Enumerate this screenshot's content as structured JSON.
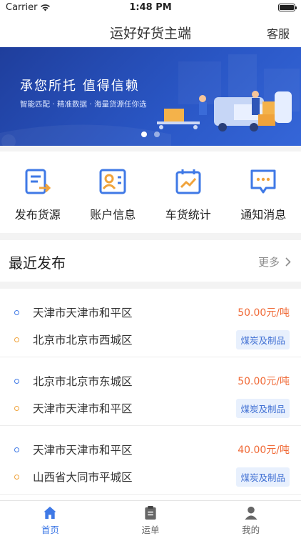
{
  "status_bar": {
    "carrier": "Carrier",
    "time": "1:48 PM"
  },
  "nav": {
    "title": "运好好货主端",
    "service": "客服"
  },
  "banner": {
    "title": "承您所托  值得信赖",
    "subtitle": "智能匹配 · 精准数据 · 海量货源任你选",
    "active_index": 0,
    "count": 2
  },
  "menu": [
    {
      "label": "发布货源",
      "icon": "publish-icon"
    },
    {
      "label": "账户信息",
      "icon": "account-icon"
    },
    {
      "label": "车货统计",
      "icon": "stats-icon"
    },
    {
      "label": "通知消息",
      "icon": "message-icon"
    }
  ],
  "recent": {
    "title": "最近发布",
    "more": "更多"
  },
  "shipments": [
    {
      "from": "天津市天津市和平区",
      "to": "北京市北京市西城区",
      "price": "50.00元/吨",
      "tag": "煤炭及制品"
    },
    {
      "from": "北京市北京市东城区",
      "to": "天津市天津市和平区",
      "price": "50.00元/吨",
      "tag": "煤炭及制品"
    },
    {
      "from": "天津市天津市和平区",
      "to": "山西省大同市平城区",
      "price": "40.00元/吨",
      "tag": "煤炭及制品"
    }
  ],
  "tabs": [
    {
      "label": "首页",
      "icon": "home-icon",
      "active": true
    },
    {
      "label": "运单",
      "icon": "waybill-icon",
      "active": false
    },
    {
      "label": "我的",
      "icon": "profile-icon",
      "active": false
    }
  ],
  "colors": {
    "primary": "#3f79e6",
    "price": "#f06a37",
    "origin": "#3f79e6",
    "destination": "#f0a33b",
    "banner": "#2a57c6"
  }
}
